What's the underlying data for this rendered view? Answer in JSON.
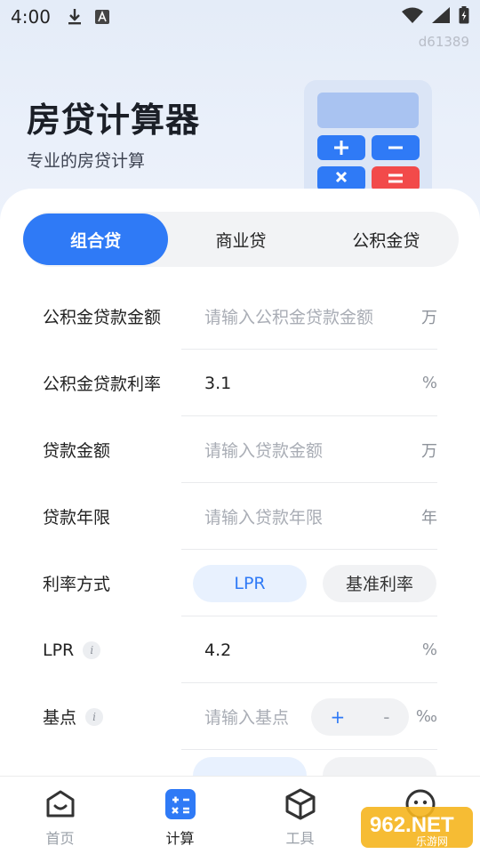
{
  "status_bar": {
    "time": "4:00"
  },
  "watermark_id": "d61389",
  "hero": {
    "title": "房贷计算器",
    "subtitle": "专业的房贷计算"
  },
  "tabs": [
    {
      "label": "组合贷",
      "active": true
    },
    {
      "label": "商业贷",
      "active": false
    },
    {
      "label": "公积金贷",
      "active": false
    }
  ],
  "form": {
    "fund_amount": {
      "label": "公积金贷款金额",
      "placeholder": "请输入公积金贷款金额",
      "unit": "万"
    },
    "fund_rate": {
      "label": "公积金贷款利率",
      "value": "3.1",
      "unit": "%"
    },
    "loan_amount": {
      "label": "贷款金额",
      "placeholder": "请输入贷款金额",
      "unit": "万"
    },
    "loan_years": {
      "label": "贷款年限",
      "placeholder": "请输入贷款年限",
      "unit": "年"
    },
    "rate_mode": {
      "label": "利率方式",
      "options": [
        "LPR",
        "基准利率"
      ],
      "selected": "LPR"
    },
    "lpr": {
      "label": "LPR",
      "value": "4.2",
      "unit": "%"
    },
    "basis_point": {
      "label": "基点",
      "placeholder": "请输入基点",
      "plus": "+",
      "minus": "-",
      "unit": "‰"
    }
  },
  "bottom_nav": [
    {
      "label": "首页",
      "icon": "home-smile-icon",
      "active": false
    },
    {
      "label": "计算",
      "icon": "calculator-icon",
      "active": true
    },
    {
      "label": "工具",
      "icon": "cube-icon",
      "active": false
    },
    {
      "label": "",
      "icon": "chat-face-icon",
      "active": false
    }
  ],
  "colors": {
    "accent": "#2f7af6",
    "background": "#eef3fb"
  }
}
